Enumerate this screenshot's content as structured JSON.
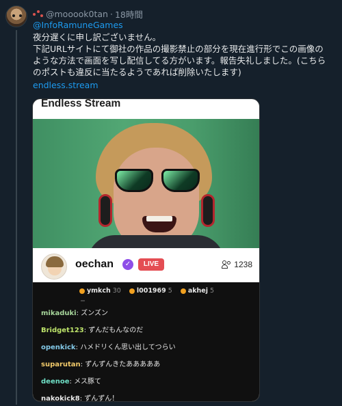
{
  "tweet": {
    "username": "@mooook0tan",
    "separator": "·",
    "time": "18時間",
    "reply_to": "@InfoRamuneGames",
    "lines": [
      "夜分遅くに申し訳ございません。",
      "下記URLサイトにて御社の作品の撮影禁止の部分を現在進行形でこの画像の",
      "ような方法で画面を写し配信してる方がいます。報告失礼しました。(こちら",
      "のポストも違反に当たるようであれば削除いたします)"
    ],
    "link": "endless.stream"
  },
  "media": {
    "stream_title": "Endless Stream",
    "streamer": "oechan",
    "live_label": "LIVE",
    "viewer_count": "1238",
    "top_users": [
      {
        "name": "ymkch",
        "count": "30"
      },
      {
        "name": "l001969",
        "count": "5"
      },
      {
        "name": "akhej",
        "count": "5"
      }
    ],
    "chat": [
      {
        "user": "mikaduki",
        "text": "ズンズン",
        "color": "#a7d69b"
      },
      {
        "user": "Bridget123",
        "text": "ずんだもんなのだ",
        "color": "#bde36a"
      },
      {
        "user": "openkick",
        "text": "ハメドリくん思い出してつらい",
        "color": "#83c9e8"
      },
      {
        "user": "suparutan",
        "text": "ずんずんきたあああああ",
        "color": "#f0c96a"
      },
      {
        "user": "deenoe",
        "text": "メス豚て",
        "color": "#6fe0c6"
      },
      {
        "user": "nakokick8",
        "text": "ずんずん！",
        "color": "#e8e8e8"
      }
    ]
  },
  "colors": {
    "background": "#15202b",
    "link": "#1d9bf0",
    "live": "#e44d53",
    "verified": "#8e4ee8"
  }
}
